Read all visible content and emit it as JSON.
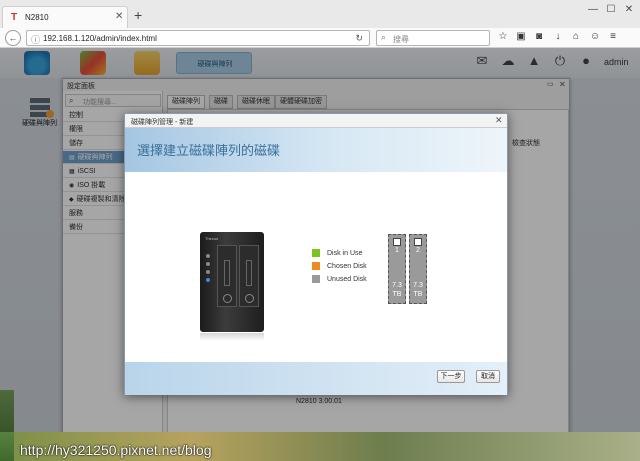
{
  "browser": {
    "tab_title": "N2810",
    "tab_favicon": "T",
    "new_tab_label": "+",
    "url": "192.168.1.120/admin/index.html",
    "search_placeholder": "搜尋",
    "window_controls": [
      "—",
      "☐",
      "✕"
    ]
  },
  "app": {
    "active_app_label": "硬碟與陣列",
    "user": "admin",
    "desktop_icon_label": "硬碟與陣列",
    "toolbar_icons": [
      "mail-icon",
      "chat-icon",
      "network-icon",
      "power-icon",
      "user-icon"
    ]
  },
  "settings": {
    "title": "設定面板",
    "search_placeholder": "功能搜尋...",
    "sidebar_items": [
      {
        "label": "控制",
        "selected": false
      },
      {
        "label": "權限",
        "selected": false
      },
      {
        "label": "儲存",
        "selected": false
      },
      {
        "label": "硬碟與陣列",
        "selected": true
      },
      {
        "label": "iSCSI",
        "selected": false
      },
      {
        "label": "ISO 掛載",
        "selected": false
      },
      {
        "label": "硬碟複製和清除",
        "selected": false
      },
      {
        "label": "服務",
        "selected": false
      },
      {
        "label": "備份",
        "selected": false
      }
    ],
    "tabs": [
      {
        "label": "磁碟陣列",
        "selected": true
      },
      {
        "label": "磁碟",
        "selected": false
      },
      {
        "label": "磁碟休眠",
        "selected": false
      },
      {
        "label": "硬體硬碟加密",
        "selected": false
      }
    ],
    "column_status": "檢查狀態",
    "version": "N2810   3.00.01"
  },
  "dialog": {
    "title": "磁碟陣列管理 - 新建",
    "heading": "選擇建立磁碟陣列的磁碟",
    "legend": [
      {
        "label": "Disk in Use",
        "color": "#7cc41f"
      },
      {
        "label": "Chosen Disk",
        "color": "#ef8b1c"
      },
      {
        "label": "Unused Disk",
        "color": "#9a9a9a"
      }
    ],
    "disks": [
      {
        "number": "1",
        "size": "7.3",
        "unit": "TB",
        "checked": false
      },
      {
        "number": "2",
        "size": "7.3",
        "unit": "TB",
        "checked": false
      }
    ],
    "nas_logo": "Thecus",
    "next_label": "下一步",
    "cancel_label": "取消"
  },
  "watermark": "http://hy321250.pixnet.net/blog"
}
